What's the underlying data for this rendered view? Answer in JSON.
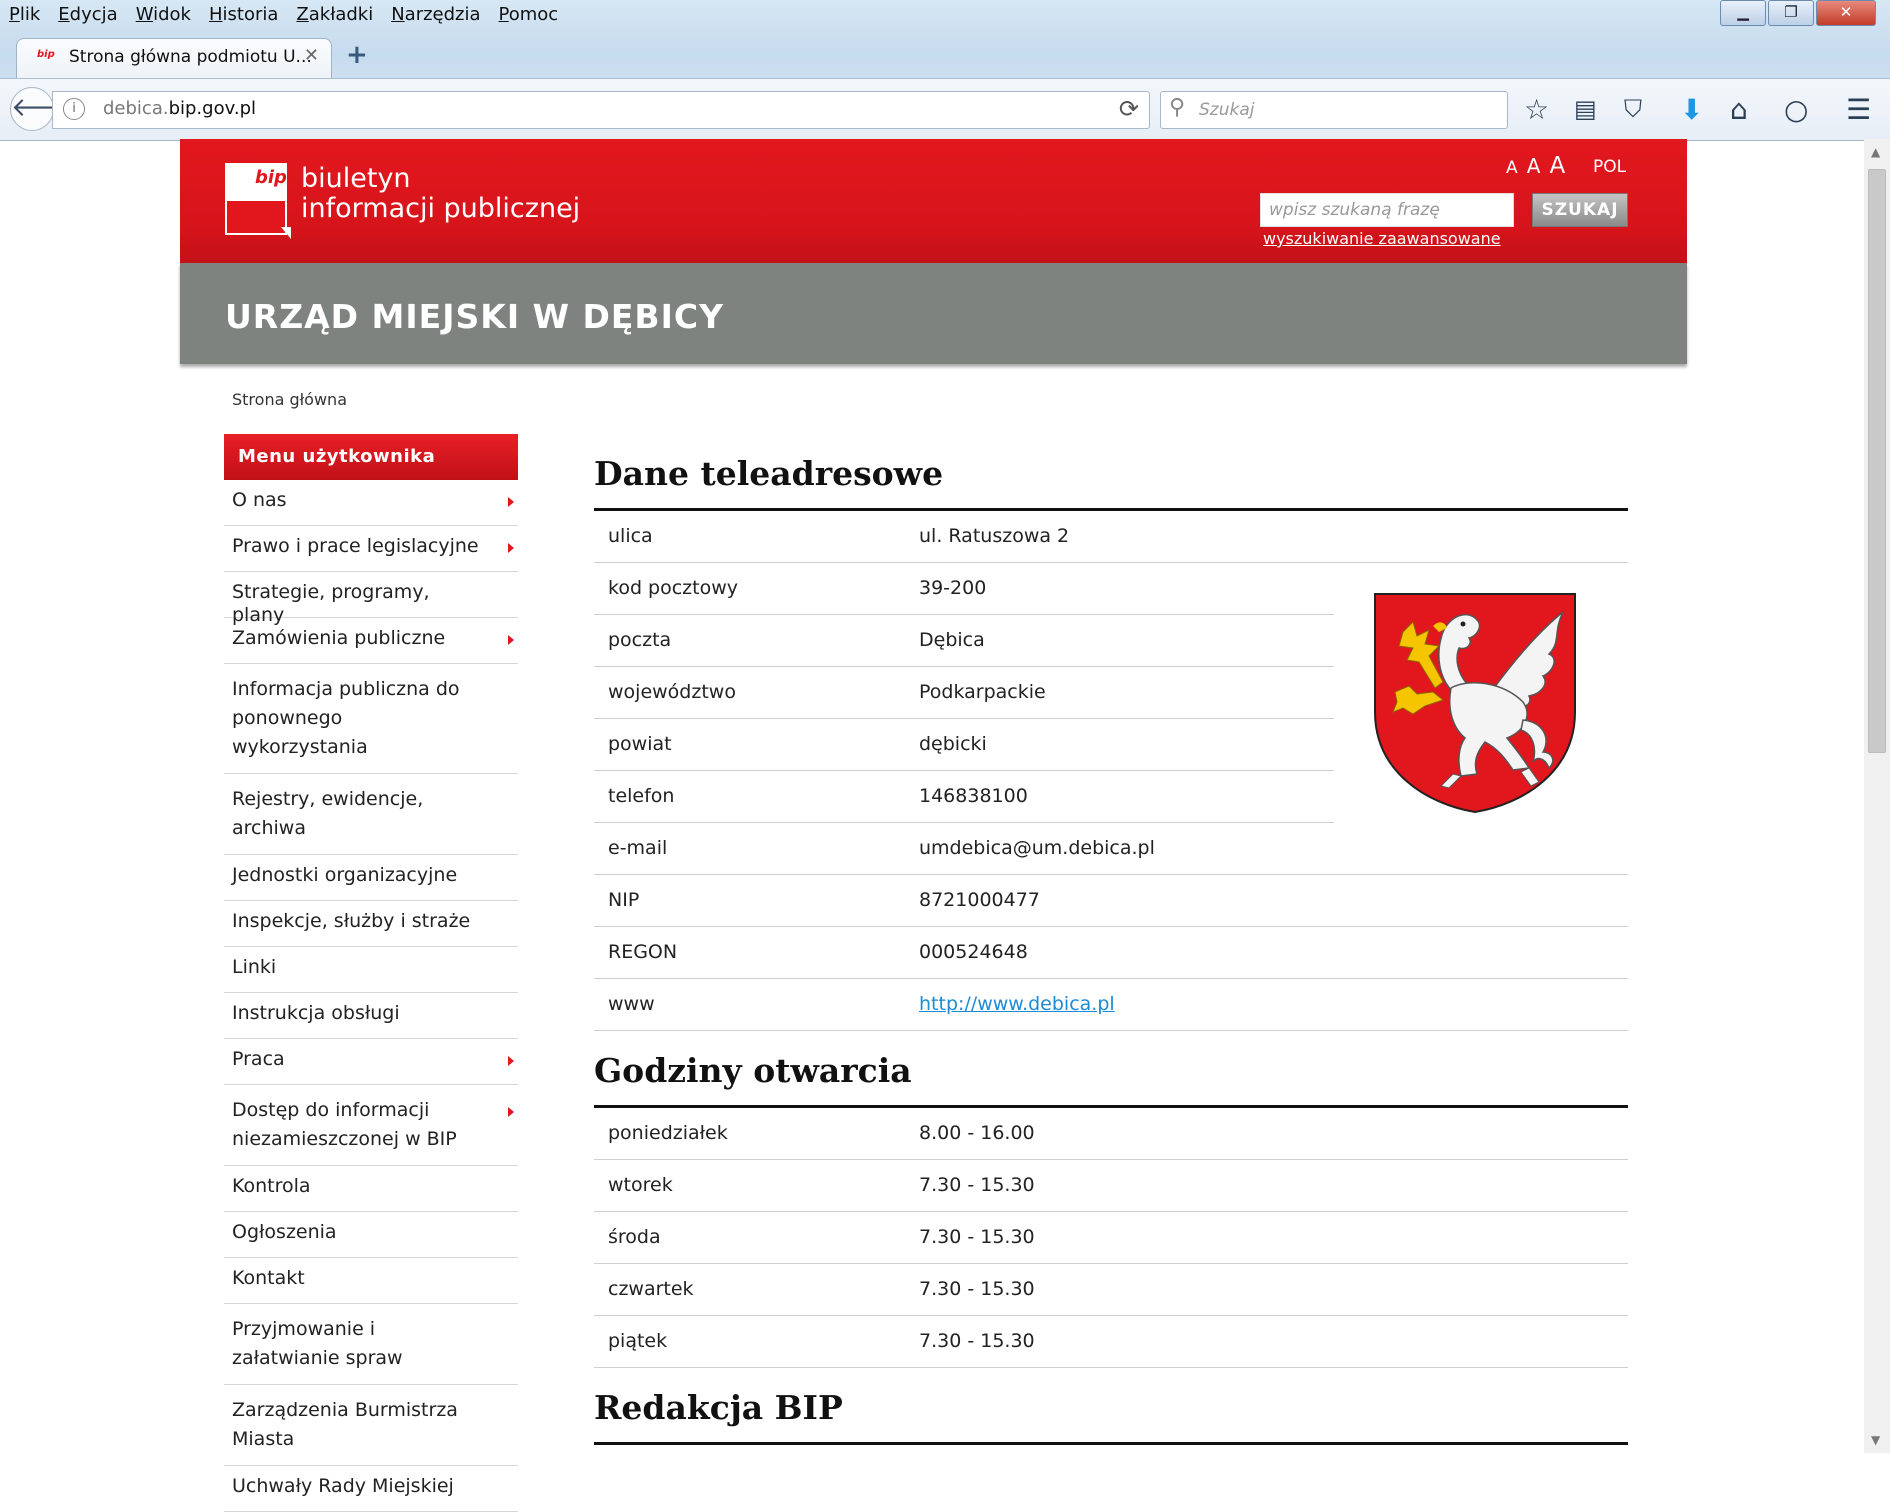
{
  "browser": {
    "menu": [
      "Plik",
      "Edycja",
      "Widok",
      "Historia",
      "Zakładki",
      "Narzędzia",
      "Pomoc"
    ],
    "tab_title": "Strona główna podmiotu U...",
    "tab_favicon": "bip",
    "url_prefix": "debica.",
    "url_domain": "bip.gov.pl",
    "search_placeholder": "Szukaj",
    "toolbar_icons": [
      "star-icon",
      "reading-list-icon",
      "pocket-icon",
      "download-icon",
      "home-icon",
      "chat-icon",
      "hamburger-menu-icon"
    ]
  },
  "header": {
    "logo_badge": "bip",
    "logo_line1": "biuletyn",
    "logo_line2": "informacji publicznej",
    "font_sizes": [
      "A",
      "A",
      "A"
    ],
    "language": "POL",
    "search_placeholder": "wpisz szukaną frazę",
    "search_button": "SZUKAJ",
    "advanced_search": "wyszukiwanie zaawansowane",
    "accent_color": "#e2161d"
  },
  "org_title": "URZĄD MIEJSKI W DĘBICY",
  "breadcrumb": "Strona główna",
  "side_menu": {
    "heading": "Menu użytkownika",
    "items": [
      {
        "label": "O nas",
        "submenu": true
      },
      {
        "label": "Prawo i prace legislacyjne",
        "submenu": true
      },
      {
        "label": "Strategie, programy, plany",
        "submenu": false
      },
      {
        "label": "Zamówienia publiczne",
        "submenu": true
      },
      {
        "label": "Informacja publiczna do ponownego wykorzystania",
        "submenu": false
      },
      {
        "label": "Rejestry, ewidencje, archiwa",
        "submenu": false
      },
      {
        "label": "Jednostki organizacyjne",
        "submenu": false
      },
      {
        "label": "Inspekcje, służby i straże",
        "submenu": false
      },
      {
        "label": "Linki",
        "submenu": false
      },
      {
        "label": "Instrukcja obsługi",
        "submenu": false
      },
      {
        "label": "Praca",
        "submenu": true
      },
      {
        "label": "Dostęp do informacji niezamieszczonej w BIP",
        "submenu": true
      },
      {
        "label": "Kontrola",
        "submenu": false
      },
      {
        "label": "Ogłoszenia",
        "submenu": false
      },
      {
        "label": "Kontakt",
        "submenu": false
      },
      {
        "label": "Przyjmowanie i załatwianie spraw",
        "submenu": false
      },
      {
        "label": "Zarządzenia Burmistrza Miasta",
        "submenu": false
      },
      {
        "label": "Uchwały Rady Miejskiej",
        "submenu": false
      }
    ]
  },
  "contact": {
    "title": "Dane teleadresowe",
    "rows": [
      {
        "key": "ulica",
        "value": "ul. Ratuszowa 2"
      },
      {
        "key": "kod pocztowy",
        "value": "39-200"
      },
      {
        "key": "poczta",
        "value": "Dębica"
      },
      {
        "key": "województwo",
        "value": "Podkarpackie"
      },
      {
        "key": "powiat",
        "value": "dębicki"
      },
      {
        "key": "telefon",
        "value": "146838100"
      },
      {
        "key": "e-mail",
        "value": "umdebica@um.debica.pl"
      },
      {
        "key": "NIP",
        "value": "8721000477"
      },
      {
        "key": "REGON",
        "value": "000524648"
      },
      {
        "key": "www",
        "value": "http://www.debica.pl"
      }
    ]
  },
  "hours": {
    "title": "Godziny otwarcia",
    "rows": [
      {
        "key": "poniedziałek",
        "value": "8.00 - 16.00"
      },
      {
        "key": "wtorek",
        "value": "7.30 - 15.30"
      },
      {
        "key": "środa",
        "value": "7.30 - 15.30"
      },
      {
        "key": "czwartek",
        "value": "7.30 - 15.30"
      },
      {
        "key": "piątek",
        "value": "7.30 - 15.30"
      }
    ]
  },
  "editorial": {
    "title": "Redakcja BIP"
  },
  "coat_of_arms": "griffin-coat-of-arms-icon"
}
